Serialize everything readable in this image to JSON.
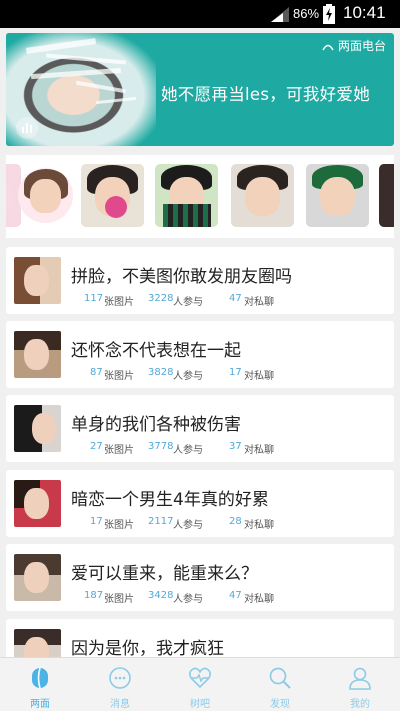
{
  "status_bar": {
    "battery_percent": "86%",
    "time": "10:41"
  },
  "banner": {
    "logo_text": "两面电台",
    "caption": "她不愿再当les，可我好爱她",
    "page_count": 2,
    "active_page": 2
  },
  "avatars": [
    {
      "name": "avatar-1"
    },
    {
      "name": "avatar-2"
    },
    {
      "name": "avatar-3"
    },
    {
      "name": "avatar-4"
    },
    {
      "name": "avatar-5"
    },
    {
      "name": "avatar-6"
    }
  ],
  "topics": [
    {
      "title": "拼脸，不美图你敢发朋友圈吗",
      "pics": "117",
      "pics_label": "张图片",
      "people": "3228",
      "people_label": "人参与",
      "chats": "47",
      "chats_label": "对私聊"
    },
    {
      "title": "还怀念不代表想在一起",
      "pics": "87",
      "pics_label": "张图片",
      "people": "3828",
      "people_label": "人参与",
      "chats": "17",
      "chats_label": "对私聊"
    },
    {
      "title": "单身的我们各种被伤害",
      "pics": "27",
      "pics_label": "张图片",
      "people": "3778",
      "people_label": "人参与",
      "chats": "37",
      "chats_label": "对私聊"
    },
    {
      "title": "暗恋一个男生4年真的好累",
      "pics": "17",
      "pics_label": "张图片",
      "people": "2117",
      "people_label": "人参与",
      "chats": "28",
      "chats_label": "对私聊"
    },
    {
      "title": "爱可以重来，能重来么？",
      "pics": "187",
      "pics_label": "张图片",
      "people": "3428",
      "people_label": "人参与",
      "chats": "47",
      "chats_label": "对私聊"
    },
    {
      "title": "因为是你，我才疯狂",
      "pics": "",
      "pics_label": "",
      "people": "",
      "people_label": "",
      "chats": "",
      "chats_label": ""
    }
  ],
  "tabs": [
    {
      "label": "两面",
      "icon": "two-faces-icon",
      "active": true
    },
    {
      "label": "消息",
      "icon": "chat-bubble-icon",
      "active": false
    },
    {
      "label": "树吧",
      "icon": "heart-pulse-icon",
      "active": false
    },
    {
      "label": "发现",
      "icon": "search-icon",
      "active": false
    },
    {
      "label": "我的",
      "icon": "user-icon",
      "active": false
    }
  ],
  "colors": {
    "accent": "#4cb3e6",
    "banner_bg": "#1eaaa2",
    "meta_number": "#52a9d8"
  }
}
